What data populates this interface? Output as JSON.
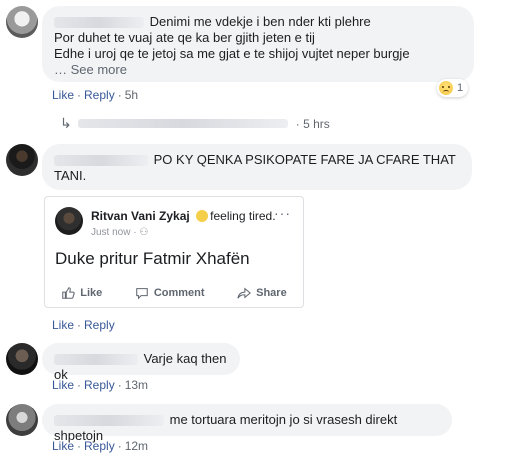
{
  "comments": [
    {
      "lines": [
        "Denimi me vdekje i ben nder kti plehre",
        "Por duhet te vuaj ate qe ka ber gjith jeten e tij",
        "Edhe i uroj qe te jetoj sa me gjat e te shijoj vujtet neper burgje"
      ],
      "see_more": "… See more",
      "like": "Like",
      "reply": "Reply",
      "time": "5h",
      "reaction_count": "1",
      "replies_time": "5 hrs"
    },
    {
      "lines": [
        "PO KY QENKA PSIKOPATE FARE JA CFARE THAT",
        "TANI."
      ],
      "like": "Like",
      "reply": "Reply",
      "shared_post": {
        "name": "Ritvan Vani Zykaj",
        "feeling": "feeling tired.",
        "sub": "Just now · ",
        "more": "···",
        "text": "Duke pritur Fatmir Xhafën",
        "like": "Like",
        "comment": "Comment",
        "share": "Share"
      }
    },
    {
      "text": "Varje kaq then ok",
      "like": "Like",
      "reply": "Reply",
      "time": "13m"
    },
    {
      "text": "me tortuara meritojn jo si vrasesh direkt shpetojn",
      "like": "Like",
      "reply": "Reply",
      "time": "12m"
    }
  ]
}
